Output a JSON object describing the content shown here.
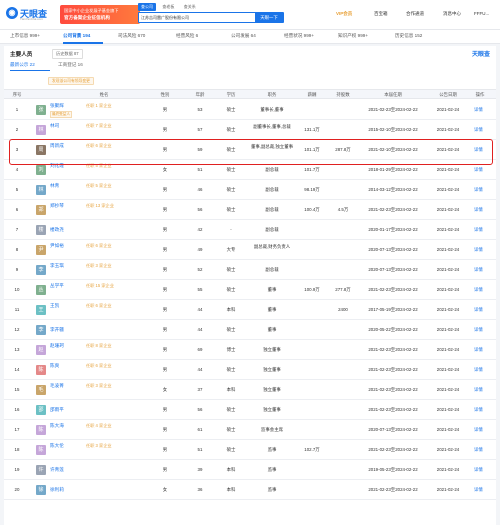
{
  "header": {
    "logo_text": "天眼查",
    "logo_sub": "TianYanCha.com",
    "promo_line1": "国家中小企业发展子基金旗下",
    "promo_line2": "官方备案企业征信机构",
    "search_tabs": [
      "查公司",
      "查老板",
      "查关系"
    ],
    "search_value": "江苏吉司雷广股份有限公司",
    "search_button": "天眼一下",
    "nav": [
      "VIP会员",
      "百宝箱",
      "合作通道",
      "消息中心",
      "FFFU..."
    ]
  },
  "tabs": [
    {
      "label": "上市信息",
      "count": "999+"
    },
    {
      "label": "公司背景",
      "count": "194"
    },
    {
      "label": "司法风险",
      "count": "670"
    },
    {
      "label": "经营风险",
      "count": "6"
    },
    {
      "label": "公司发展",
      "count": "64"
    },
    {
      "label": "经营状况",
      "count": "999+"
    },
    {
      "label": "知识产权",
      "count": "999+"
    },
    {
      "label": "历史信息",
      "count": "152"
    }
  ],
  "section": {
    "title": "主要人员",
    "history_tag": "历史数据",
    "history_count": "87",
    "brand": "天眼查",
    "subtabs": [
      "最新公示 22",
      "工商登记 16"
    ],
    "notice": "发现该公司有领导变更"
  },
  "columns": [
    "序号",
    "姓名",
    "性别",
    "年龄",
    "学历",
    "职务",
    "薪酬",
    "持股数",
    "本届任期",
    "公告日期",
    "操作"
  ],
  "rows": [
    {
      "idx": "1",
      "name": "张聚辉",
      "avatar": "张",
      "color": "#7fb08f",
      "roles": "任职 1 家企业",
      "badge": "最终受益人",
      "gender": "男",
      "age": "53",
      "edu": "硕士",
      "title": "董事长,董事",
      "pay": "",
      "shares": "",
      "term": "2021-02-23至2024-02-22",
      "date": "2021-02-24",
      "op": "详情"
    },
    {
      "idx": "2",
      "name": "林司",
      "avatar": "林",
      "color": "#c5a6d9",
      "roles": "任职 7 家企业",
      "gender": "男",
      "age": "57",
      "edu": "硕士",
      "title": "副董事长,董事,总裁",
      "pay": "131.1万",
      "shares": "",
      "term": "2015-02-10至2024-02-22",
      "date": "2021-02-24",
      "op": "详情"
    },
    {
      "idx": "3",
      "name": "周新成",
      "avatar": "周",
      "color": "#8a7664",
      "roles": "任职 6 家企业",
      "gender": "男",
      "age": "59",
      "edu": "硕士",
      "title": "董事,副总裁,独立董事",
      "pay": "101.1万",
      "shares": "287.8万",
      "term": "2021-02-10至2024-02-22",
      "date": "2021-02-24",
      "op": "详情"
    },
    {
      "idx": "4",
      "name": "刘化霞",
      "avatar": "刘",
      "color": "#7fb08f",
      "roles": "任职 5 家企业",
      "gender": "女",
      "age": "51",
      "edu": "硕士",
      "title": "副总裁",
      "pay": "101.7万",
      "shares": "",
      "term": "2018-01-29至2024-02-22",
      "date": "2021-02-24",
      "op": "详情"
    },
    {
      "idx": "5",
      "name": "林青",
      "avatar": "林",
      "color": "#74a8c9",
      "roles": "任职 5 家企业",
      "gender": "男",
      "age": "46",
      "edu": "硕士",
      "title": "副总裁",
      "pay": "98.19万",
      "shares": "",
      "term": "2014-03-12至2024-02-22",
      "date": "2021-02-24",
      "op": "详情"
    },
    {
      "idx": "6",
      "name": "郑抄琴",
      "avatar": "郑",
      "color": "#c9a56a",
      "roles": "任职 13 家企业",
      "gender": "男",
      "age": "56",
      "edu": "硕士",
      "title": "副总裁",
      "pay": "100.4万",
      "shares": "4.5万",
      "term": "2021-02-23至2024-02-22",
      "date": "2021-02-24",
      "op": "详情"
    },
    {
      "idx": "7",
      "name": "楼政尧",
      "avatar": "楼",
      "color": "#9aa4b4",
      "roles": "",
      "gender": "男",
      "age": "42",
      "edu": "-",
      "title": "副总裁",
      "pay": "",
      "shares": "",
      "term": "2020-01-17至2024-02-22",
      "date": "2021-02-24",
      "op": "详情"
    },
    {
      "idx": "8",
      "name": "尹如裕",
      "avatar": "尹",
      "color": "#c9a56a",
      "roles": "任职 6 家企业",
      "gender": "男",
      "age": "49",
      "edu": "大专",
      "title": "副总裁,财务负责人",
      "pay": "",
      "shares": "",
      "term": "2020-07-13至2024-02-22",
      "date": "2021-02-24",
      "op": "详情"
    },
    {
      "idx": "9",
      "name": "李玉琪",
      "avatar": "李",
      "color": "#74a8c9",
      "roles": "任职 3 家企业",
      "gender": "男",
      "age": "52",
      "edu": "硕士",
      "title": "副总裁",
      "pay": "",
      "shares": "",
      "term": "2020-07-13至2024-02-22",
      "date": "2021-02-24",
      "op": "详情"
    },
    {
      "idx": "10",
      "name": "丛学平",
      "avatar": "丛",
      "color": "#7fb08f",
      "roles": "任职 15 家企业",
      "gender": "男",
      "age": "55",
      "edu": "硕士",
      "title": "董事",
      "pay": "100.9万",
      "shares": "277.8万",
      "term": "2021-02-23至2024-02-22",
      "date": "2021-02-24",
      "op": "详情"
    },
    {
      "idx": "11",
      "name": "王凯",
      "avatar": "王",
      "color": "#6cc0c4",
      "roles": "任职 6 家企业",
      "gender": "男",
      "age": "44",
      "edu": "本科",
      "title": "董事",
      "pay": "",
      "shares": "2400",
      "term": "2017-05-19至2024-02-22",
      "date": "2021-02-24",
      "op": "详情"
    },
    {
      "idx": "12",
      "name": "李开疆",
      "avatar": "李",
      "color": "#74a8c9",
      "roles": "",
      "gender": "男",
      "age": "44",
      "edu": "硕士",
      "title": "董事",
      "pay": "",
      "shares": "",
      "term": "2020-05-22至2024-02-22",
      "date": "2021-02-24",
      "op": "详情"
    },
    {
      "idx": "13",
      "name": "赵珊珂",
      "avatar": "赵",
      "color": "#c5a6d9",
      "roles": "任职 8 家企业",
      "gender": "男",
      "age": "69",
      "edu": "博士",
      "title": "独立董事",
      "pay": "",
      "shares": "",
      "term": "2021-02-23至2024-02-22",
      "date": "2021-02-24",
      "op": "详情"
    },
    {
      "idx": "14",
      "name": "陈爽",
      "avatar": "陈",
      "color": "#e48888",
      "roles": "任职 6 家企业",
      "gender": "男",
      "age": "44",
      "edu": "硕士",
      "title": "独立董事",
      "pay": "",
      "shares": "",
      "term": "2021-02-23至2024-02-22",
      "date": "2021-02-24",
      "op": "详情"
    },
    {
      "idx": "15",
      "name": "毛凌菁",
      "avatar": "毛",
      "color": "#c9a56a",
      "roles": "任职 3 家企业",
      "gender": "女",
      "age": "37",
      "edu": "本科",
      "title": "独立董事",
      "pay": "",
      "shares": "",
      "term": "2021-02-23至2024-02-22",
      "date": "2021-02-24",
      "op": "详情"
    },
    {
      "idx": "16",
      "name": "邵雨平",
      "avatar": "邵",
      "color": "#6cc0c4",
      "roles": "",
      "gender": "男",
      "age": "56",
      "edu": "硕士",
      "title": "独立董事",
      "pay": "",
      "shares": "",
      "term": "2021-02-23至2024-02-22",
      "date": "2021-02-24",
      "op": "详情"
    },
    {
      "idx": "17",
      "name": "陈大海",
      "avatar": "陈",
      "color": "#c5a6d9",
      "roles": "任职 4 家企业",
      "gender": "男",
      "age": "61",
      "edu": "硕士",
      "title": "监事会主席",
      "pay": "",
      "shares": "",
      "term": "2020-07-13至2024-02-22",
      "date": "2021-02-24",
      "op": "详情"
    },
    {
      "idx": "18",
      "name": "陈大伦",
      "avatar": "陈",
      "color": "#c5a6d9",
      "roles": "任职 3 家企业",
      "gender": "男",
      "age": "51",
      "edu": "硕士",
      "title": "监事",
      "pay": "102.7万",
      "shares": "",
      "term": "2021-02-23至2024-02-22",
      "date": "2021-02-24",
      "op": "详情"
    },
    {
      "idx": "19",
      "name": "许青莲",
      "avatar": "许",
      "color": "#9aa4b4",
      "roles": "",
      "gender": "男",
      "age": "39",
      "edu": "本科",
      "title": "监事",
      "pay": "",
      "shares": "",
      "term": "2019-05-23至2024-02-22",
      "date": "2021-02-24",
      "op": "详情"
    },
    {
      "idx": "20",
      "name": "徐利莉",
      "avatar": "徐",
      "color": "#74a8c9",
      "roles": "",
      "gender": "女",
      "age": "36",
      "edu": "本科",
      "title": "监事",
      "pay": "",
      "shares": "",
      "term": "2021-02-23至2024-02-22",
      "date": "2021-02-24",
      "op": "详情"
    }
  ]
}
